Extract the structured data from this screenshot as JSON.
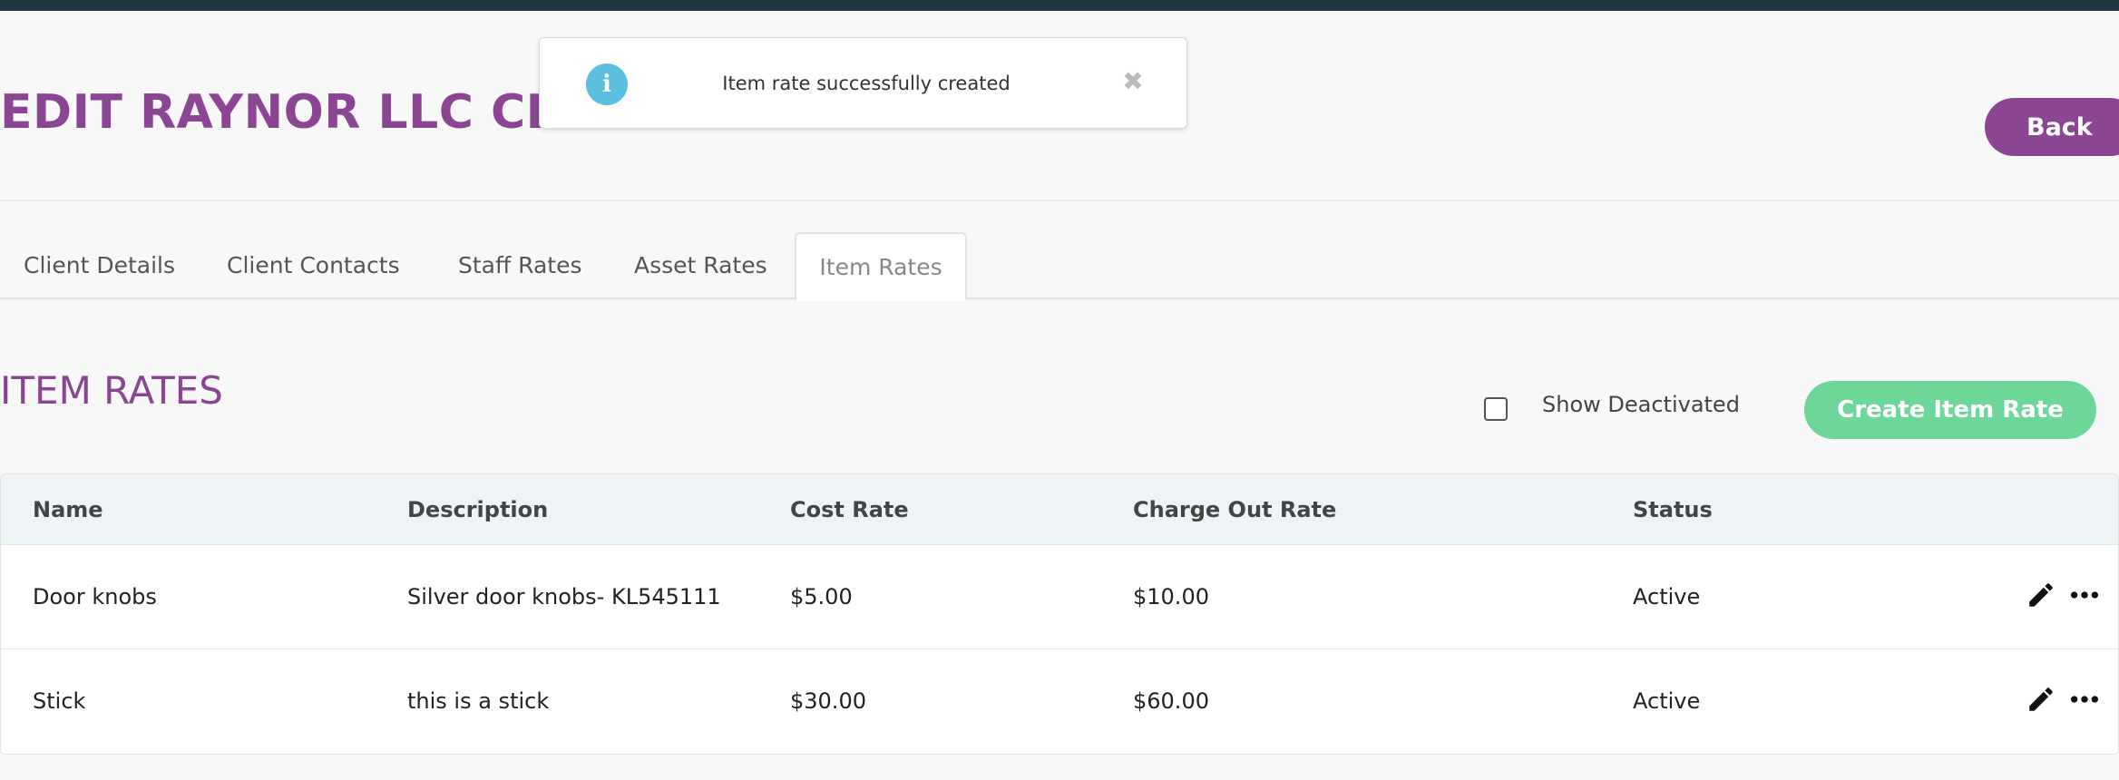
{
  "page": {
    "title": "EDIT RAYNOR LLC CLIENT",
    "back_label": "Back"
  },
  "toast": {
    "icon": "info-icon",
    "message": "Item rate successfully created",
    "close_icon": "close-icon"
  },
  "tabs": [
    {
      "label": "Client Details",
      "active": false
    },
    {
      "label": "Client Contacts",
      "active": false
    },
    {
      "label": "Staff Rates",
      "active": false
    },
    {
      "label": "Asset Rates",
      "active": false
    },
    {
      "label": "Item Rates",
      "active": true
    }
  ],
  "section": {
    "title": "ITEM RATES",
    "show_deactivated_label": "Show Deactivated",
    "show_deactivated_checked": false,
    "create_label": "Create Item Rate"
  },
  "table": {
    "columns": [
      "Name",
      "Description",
      "Cost Rate",
      "Charge Out Rate",
      "Status"
    ],
    "rows": [
      {
        "name": "Door knobs",
        "description": "Silver door knobs- KL545111",
        "cost_rate": "$5.00",
        "charge_out_rate": "$10.00",
        "status": "Active"
      },
      {
        "name": "Stick",
        "description": "this is a stick",
        "cost_rate": "$30.00",
        "charge_out_rate": "$60.00",
        "status": "Active"
      }
    ],
    "row_actions": [
      "pencil-icon",
      "more-horizontal-icon"
    ]
  },
  "colors": {
    "topbar": "#1f3845",
    "brand_purple": "#8a4693",
    "create_green": "#6dd79a",
    "info_blue": "#5bc0de",
    "table_header_bg": "#eef3f6"
  }
}
